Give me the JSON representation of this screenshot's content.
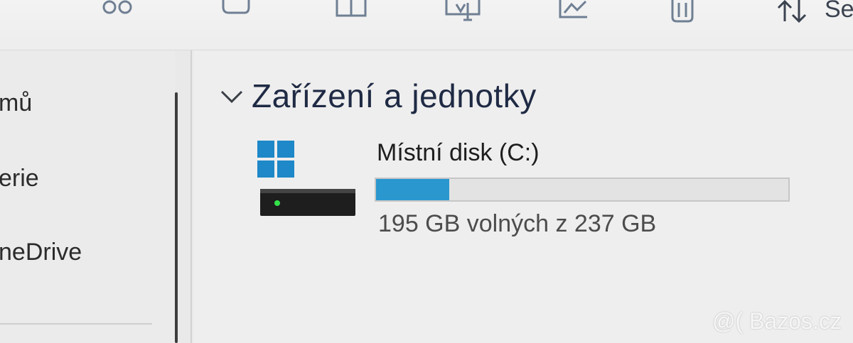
{
  "toolbar": {
    "icons": [
      "view-icon",
      "copy-icon",
      "paste-icon",
      "rename-icon",
      "share-icon",
      "delete-icon"
    ],
    "sort_label": "Se"
  },
  "sidebar": {
    "items": [
      {
        "label": "mů"
      },
      {
        "label": "erie"
      },
      {
        "label": "neDrive"
      }
    ]
  },
  "main": {
    "group_title": "Zařízení a jednotky",
    "drive": {
      "name": "Místní disk (C:)",
      "free_text": "195 GB volných z 237 GB",
      "used_fraction": 0.177
    }
  },
  "colors": {
    "accent": "#2a97cf",
    "windows_logo": "#1e88c8"
  },
  "watermark": "@( Bazos.cz"
}
